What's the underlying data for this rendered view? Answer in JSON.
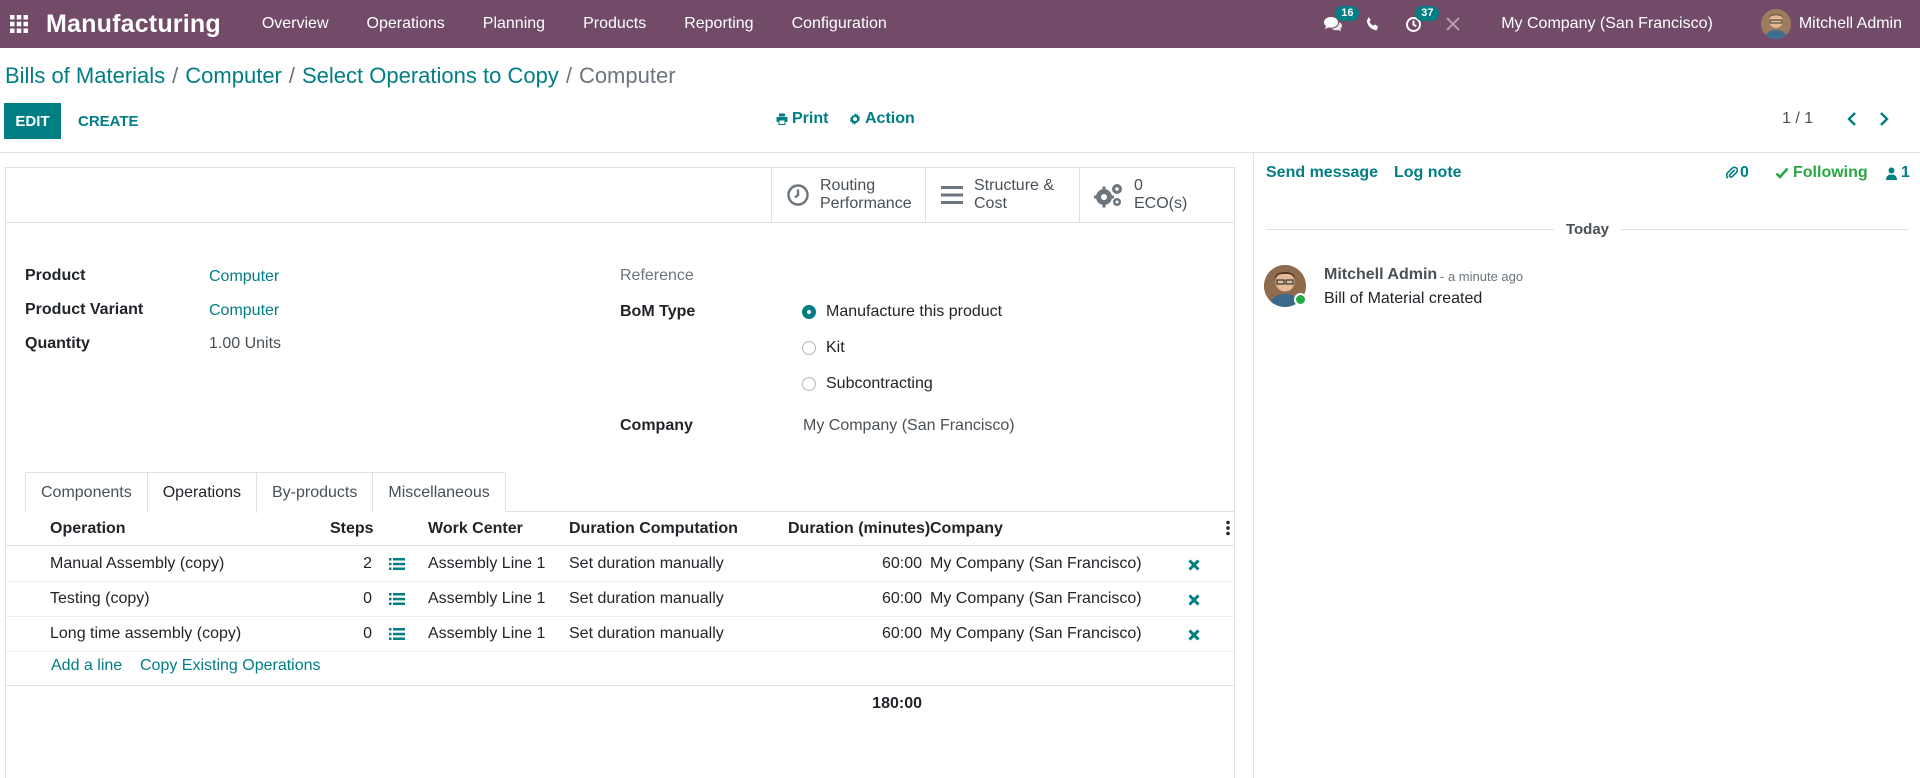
{
  "navbar": {
    "app_title": "Manufacturing",
    "menu": [
      "Overview",
      "Operations",
      "Planning",
      "Products",
      "Reporting",
      "Configuration"
    ],
    "messages_count": "16",
    "activities_count": "37",
    "company": "My Company (San Francisco)",
    "user": "Mitchell Admin",
    "bg_color": "#714B67"
  },
  "breadcrumb": {
    "items": [
      "Bills of Materials",
      "Computer",
      "Select Operations to Copy"
    ],
    "current": "Computer"
  },
  "controls": {
    "edit_label": "EDIT",
    "create_label": "CREATE",
    "print_label": "Print",
    "action_label": "Action",
    "pager": "1 / 1"
  },
  "stat_buttons": {
    "routing_line1": "Routing",
    "routing_line2": "Performance",
    "structure_line1": "Structure &",
    "structure_line2": "Cost",
    "eco_count": "0",
    "eco_label": "ECO(s)"
  },
  "form": {
    "product_label": "Product",
    "product_value": "Computer",
    "variant_label": "Product Variant",
    "variant_value": "Computer",
    "quantity_label": "Quantity",
    "quantity_value": "1.00",
    "quantity_uom": "Units",
    "reference_label": "Reference",
    "bom_type_label": "BoM Type",
    "bom_type_options": [
      "Manufacture this product",
      "Kit",
      "Subcontracting"
    ],
    "bom_type_selected": "Manufacture this product",
    "company_label": "Company",
    "company_value": "My Company (San Francisco)"
  },
  "tabs": {
    "items": [
      "Components",
      "Operations",
      "By-products",
      "Miscellaneous"
    ],
    "active": "Operations"
  },
  "operations_table": {
    "headers": {
      "operation": "Operation",
      "steps": "Steps",
      "work_center": "Work Center",
      "duration_computation": "Duration Computation",
      "duration": "Duration (minutes)",
      "company": "Company"
    },
    "rows": [
      {
        "operation": "Manual Assembly (copy)",
        "steps": "2",
        "work_center": "Assembly Line 1",
        "duration_computation": "Set duration manually",
        "duration": "60:00",
        "company": "My Company (San Francisco)"
      },
      {
        "operation": "Testing (copy)",
        "steps": "0",
        "work_center": "Assembly Line 1",
        "duration_computation": "Set duration manually",
        "duration": "60:00",
        "company": "My Company (San Francisco)"
      },
      {
        "operation": "Long time assembly (copy)",
        "steps": "0",
        "work_center": "Assembly Line 1",
        "duration_computation": "Set duration manually",
        "duration": "60:00",
        "company": "My Company (San Francisco)"
      }
    ],
    "add_line": "Add a line",
    "copy_existing": "Copy Existing Operations",
    "total_duration": "180:00"
  },
  "chatter": {
    "send_message": "Send message",
    "log_note": "Log note",
    "attachments_count": "0",
    "following_label": "Following",
    "followers_count": "1",
    "date_separator": "Today",
    "message": {
      "author": "Mitchell Admin",
      "date": "- a minute ago",
      "body": "Bill of Material created"
    }
  },
  "colors": {
    "accent": "#017E84",
    "following": "#28a745"
  }
}
